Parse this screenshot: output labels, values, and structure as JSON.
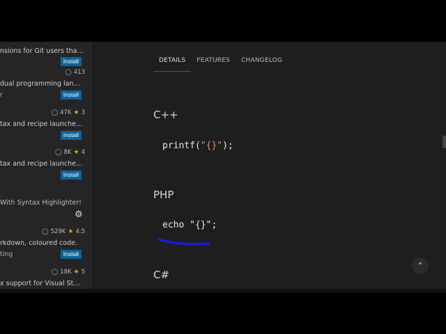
{
  "details": {
    "tabs": [
      "DETAILS",
      "FEATURES",
      "CHANGELOG"
    ],
    "sections": [
      {
        "title": "C++",
        "code_prefix": "printf(",
        "code_str": "\"{}\"",
        "code_suffix": ");"
      },
      {
        "title": "PHP",
        "code_prefix": "echo ",
        "code_str": "\"{}\"",
        "code_suffix": ";"
      },
      {
        "title": "C#"
      }
    ]
  },
  "sidebar": {
    "items": [
      {
        "desc": "nsions for Git users that ...",
        "install": "Install"
      },
      {
        "downloads": "413",
        "desc": "dual programming lang...",
        "sub": "r",
        "install": "Install"
      },
      {
        "downloads": "47K",
        "rating": "3",
        "desc": "tax and recipe launcher f...",
        "install": "Install"
      },
      {
        "downloads": "8K",
        "rating": "4",
        "desc": "tax and recipe launcher f...",
        "install": "Install"
      },
      {
        "desc": "With Syntax Highlighter!"
      },
      {
        "downloads": "529K",
        "rating": "4.5",
        "desc": "rkdown, coloured code.",
        "sub": "ting",
        "install": "Install"
      },
      {
        "downloads": "18K",
        "rating": "5",
        "desc": "x support for Visual Stud..."
      }
    ]
  },
  "colors": {
    "accent": "#0e639c",
    "annotation": "#1a1adb",
    "star": "#e2a13a"
  }
}
